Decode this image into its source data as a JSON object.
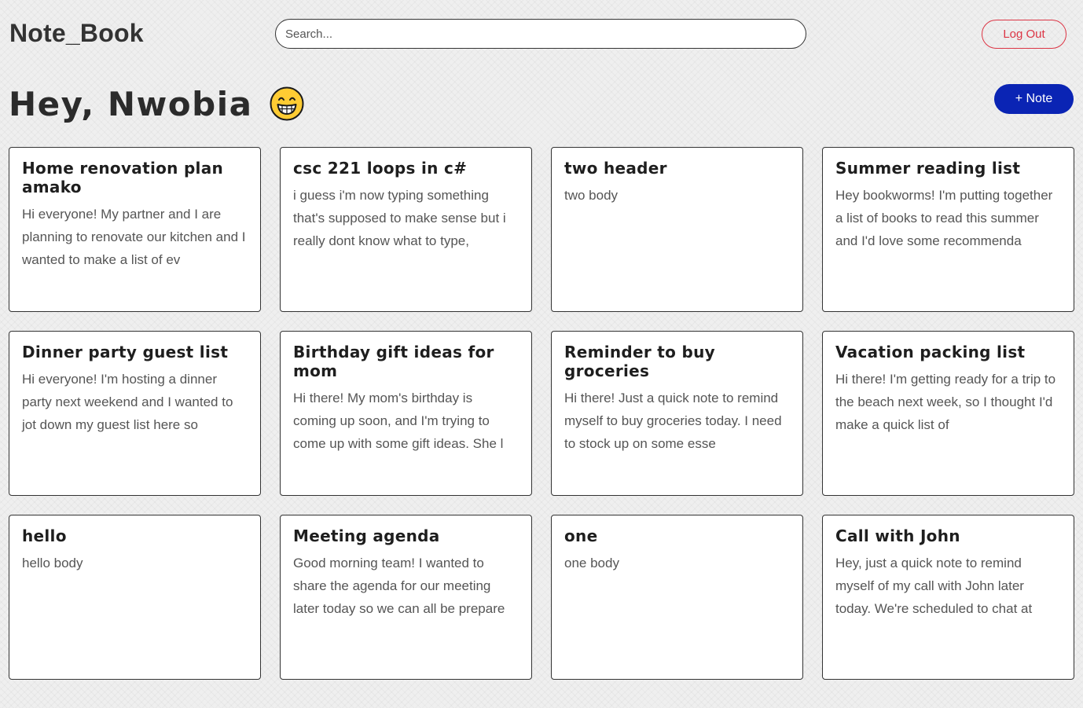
{
  "header": {
    "brand": "Note_Book",
    "search_placeholder": "Search...",
    "logout_label": "Log Out"
  },
  "greeting": {
    "text": "Hey, Nwobia",
    "emoji_icon": "grinning-face-icon"
  },
  "add_note_label": "+ Note",
  "colors": {
    "primary": "#0a24b4",
    "danger": "#dc3545",
    "emoji_yellow": "#ffcc33"
  },
  "notes": [
    {
      "title": "Home renovation plan amako",
      "body": "Hi everyone! My partner and I are planning to renovate our kitchen and I wanted to make a list of ev"
    },
    {
      "title": "csc 221 loops in c#",
      "body": "i guess i'm now typing something that's supposed to make sense but i really dont know what to type,"
    },
    {
      "title": "two header",
      "body": "two body"
    },
    {
      "title": "Summer reading list",
      "body": "Hey bookworms! I'm putting together a list of books to read this summer and I'd love some recommenda"
    },
    {
      "title": "Dinner party guest list",
      "body": "Hi everyone! I'm hosting a dinner party next weekend and I wanted to jot down my guest list here so"
    },
    {
      "title": "Birthday gift ideas for mom",
      "body": "Hi there! My mom's birthday is coming up soon, and I'm trying to come up with some gift ideas. She l"
    },
    {
      "title": "Reminder to buy groceries",
      "body": "Hi there! Just a quick note to remind myself to buy groceries today. I need to stock up on some esse"
    },
    {
      "title": "Vacation packing list",
      "body": "Hi there! I'm getting ready for a trip to the beach next week, so I thought I'd make a quick list of"
    },
    {
      "title": "hello",
      "body": "hello body"
    },
    {
      "title": "Meeting agenda",
      "body": "Good morning team! I wanted to share the agenda for our meeting later today so we can all be prepare"
    },
    {
      "title": "one",
      "body": "one body"
    },
    {
      "title": "Call with John",
      "body": "Hey, just a quick note to remind myself of my call with John later today. We're scheduled to chat at"
    }
  ]
}
